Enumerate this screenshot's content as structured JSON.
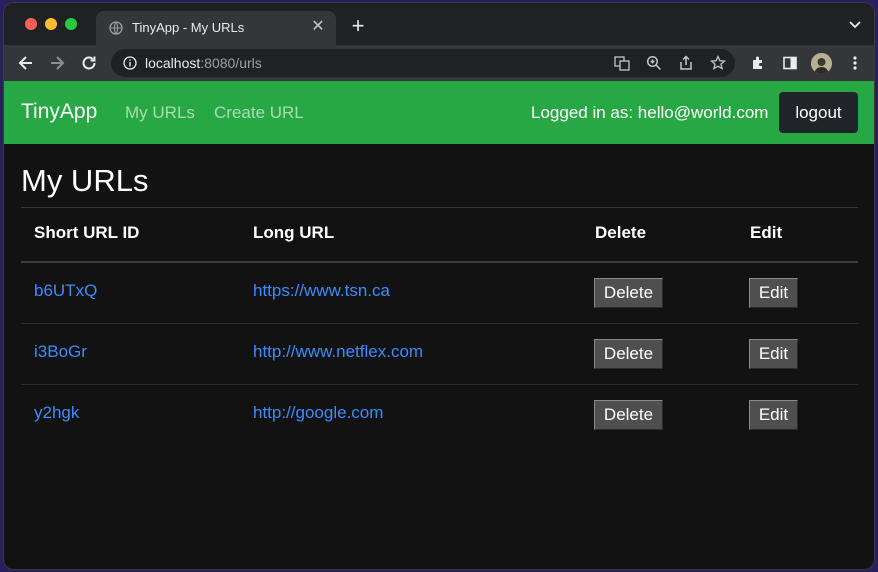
{
  "browser": {
    "tab_title": "TinyApp - My URLs",
    "url_host": "localhost",
    "url_rest": ":8080/urls"
  },
  "navbar": {
    "brand": "TinyApp",
    "links": [
      "My URLs",
      "Create URL"
    ],
    "login_text": "Logged in as: hello@world.com",
    "logout_label": "logout",
    "color": "#28a745"
  },
  "main": {
    "title": "My URLs",
    "headers": [
      "Short URL ID",
      "Long URL",
      "Delete",
      "Edit"
    ],
    "rows": [
      {
        "id": "b6UTxQ",
        "long_url": "https://www.tsn.ca",
        "delete_label": "Delete",
        "edit_label": "Edit"
      },
      {
        "id": "i3BoGr",
        "long_url": "http://www.netflex.com",
        "delete_label": "Delete",
        "edit_label": "Edit"
      },
      {
        "id": "y2hgk",
        "long_url": "http://google.com",
        "delete_label": "Delete",
        "edit_label": "Edit"
      }
    ],
    "link_color": "#3d8bfd"
  }
}
